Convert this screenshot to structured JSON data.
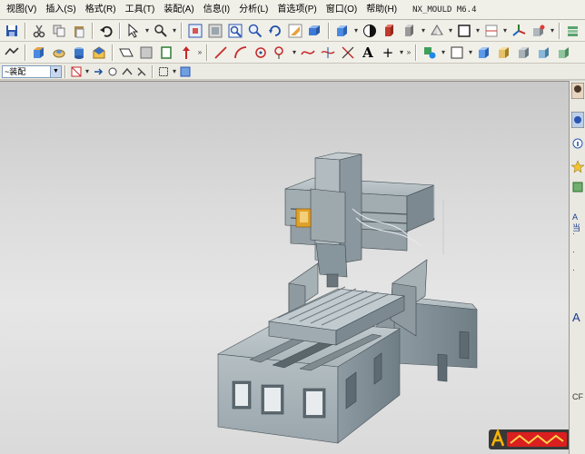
{
  "menu": {
    "items": [
      "视图(V)",
      "插入(S)",
      "格式(R)",
      "工具(T)",
      "装配(A)",
      "信息(I)",
      "分析(L)",
      "首选项(P)",
      "窗口(O)",
      "帮助(H)"
    ],
    "title": "NX_MOULD M6.4"
  },
  "toolbar3": {
    "filter_value": "~装配"
  },
  "resource_bar": {
    "labels": [
      "A当",
      "A",
      "CF"
    ]
  },
  "icons": {
    "toolbar1": [
      "save-icon",
      "cut-icon",
      "copy-icon",
      "paste-icon",
      "undo-icon",
      "select-icon",
      "command-finder-icon",
      "fit-view-icon",
      "zoom-icon",
      "zoom-window-icon",
      "zoom-in-icon",
      "rotate-icon",
      "pan-icon",
      "perspective-icon",
      "shaded-cube-icon",
      "orient-view-icon",
      "render-style-icon",
      "section-view-icon",
      "layer-icon",
      "color-icon",
      "display-icon",
      "wcs-icon",
      "part-navigator-icon",
      "assembly-icon",
      "constraint-icon",
      "mould-tools-icon"
    ],
    "toolbar2": [
      "feature-icon",
      "extrude-icon",
      "revolve-icon",
      "hole-icon",
      "blend-icon",
      "boolean-icon",
      "sketch-icon",
      "rectangle-icon",
      "arrow-up-icon",
      "line-icon",
      "arc-icon",
      "point-icon",
      "circle-icon",
      "spline-icon",
      "trim-icon",
      "offset-icon",
      "text-icon",
      "plus-icon",
      "group-icon",
      "box-icon",
      "cylinder-icon",
      "sphere-icon",
      "block-icon",
      "cone-icon",
      "layer-settings-icon"
    ],
    "toolbar3": [
      "filter-icon",
      "snap-point-icon",
      "snap-end-icon",
      "snap-mid-icon",
      "snap-center-icon",
      "select-rect-icon",
      "view-icon"
    ]
  },
  "colors": {
    "background": "#d4d0c8",
    "menubar": "#f0efe8",
    "viewport_top": "#c9c9c9",
    "viewport_bottom": "#e6e6e6",
    "model_light": "#b8c2c6",
    "model_mid": "#9eaab0",
    "model_dark": "#6f7d85",
    "highlight": "#e0a12a"
  }
}
